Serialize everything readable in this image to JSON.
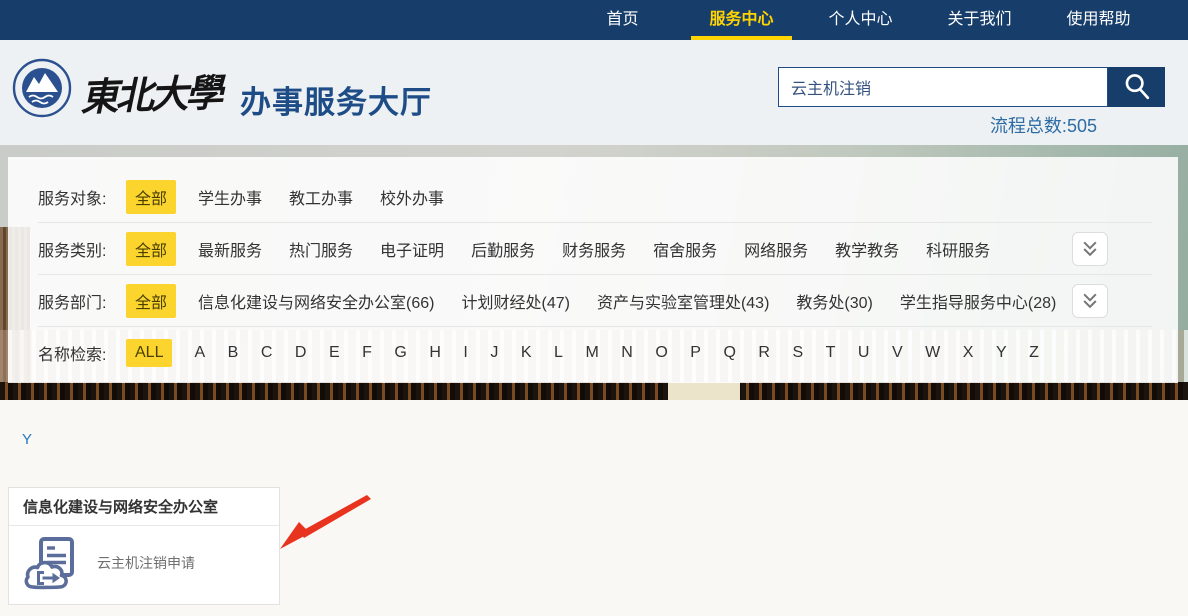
{
  "nav": {
    "items": [
      {
        "label": "首页",
        "active": false
      },
      {
        "label": "服务中心",
        "active": true
      },
      {
        "label": "个人中心",
        "active": false
      },
      {
        "label": "关于我们",
        "active": false
      },
      {
        "label": "使用帮助",
        "active": false
      }
    ]
  },
  "header": {
    "logotype": "東北大學",
    "site_title": "办事服务大厅",
    "search": {
      "value": "云主机注销"
    },
    "flow_total_label": "流程总数:",
    "flow_total_value": "505"
  },
  "filters": {
    "rows": [
      {
        "label": "服务对象:",
        "selected": "全部",
        "options": [
          "学生办事",
          "教工办事",
          "校外办事"
        ],
        "expandable": false
      },
      {
        "label": "服务类别:",
        "selected": "全部",
        "options": [
          "最新服务",
          "热门服务",
          "电子证明",
          "后勤服务",
          "财务服务",
          "宿舍服务",
          "网络服务",
          "教学教务",
          "科研服务"
        ],
        "expandable": true
      },
      {
        "label": "服务部门:",
        "selected": "全部",
        "options": [
          "信息化建设与网络安全办公室(66)",
          "计划财经处(47)",
          "资产与实验室管理处(43)",
          "教务处(30)",
          "学生指导服务中心(28)"
        ],
        "expandable": true
      },
      {
        "label": "名称检索:",
        "selected": "ALL",
        "options": [
          "A",
          "B",
          "C",
          "D",
          "E",
          "F",
          "G",
          "H",
          "I",
          "J",
          "K",
          "L",
          "M",
          "N",
          "O",
          "P",
          "Q",
          "R",
          "S",
          "T",
          "U",
          "V",
          "W",
          "X",
          "Y",
          "Z"
        ],
        "expandable": false
      }
    ]
  },
  "results": {
    "letter_heading": "Y",
    "cards": [
      {
        "department": "信息化建设与网络安全办公室",
        "items": [
          {
            "label": "云主机注销申请",
            "icon": "cloud-document-export-icon"
          }
        ]
      }
    ]
  },
  "colors": {
    "nav_bg": "#173e6b",
    "accent_yellow": "#ffd400",
    "badge_yellow": "#fcd42e",
    "title_blue": "#1d4c87",
    "flow_total_blue": "#2d6ca5",
    "letter_heading_blue": "#2478be",
    "icon_slate_blue": "#5b6d9a",
    "annotation_red": "#e8341f"
  }
}
